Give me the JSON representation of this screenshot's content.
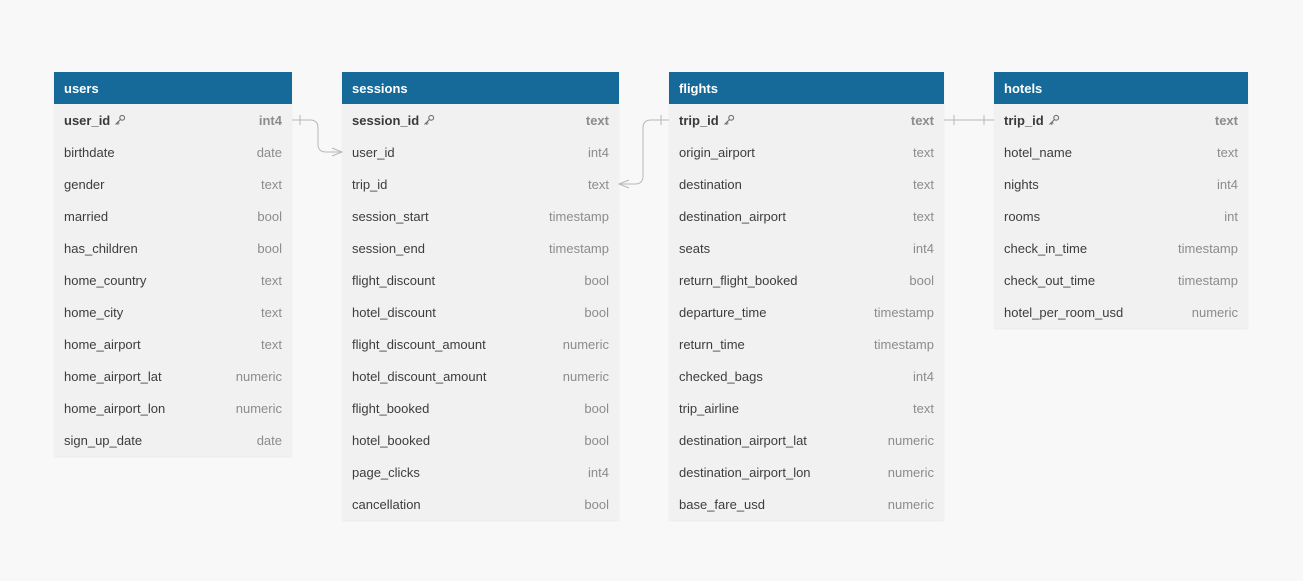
{
  "tables": {
    "users": {
      "name": "users",
      "fields": [
        {
          "name": "user_id",
          "type": "int4",
          "pk": true
        },
        {
          "name": "birthdate",
          "type": "date"
        },
        {
          "name": "gender",
          "type": "text"
        },
        {
          "name": "married",
          "type": "bool"
        },
        {
          "name": "has_children",
          "type": "bool"
        },
        {
          "name": "home_country",
          "type": "text"
        },
        {
          "name": "home_city",
          "type": "text"
        },
        {
          "name": "home_airport",
          "type": "text"
        },
        {
          "name": "home_airport_lat",
          "type": "numeric"
        },
        {
          "name": "home_airport_lon",
          "type": "numeric"
        },
        {
          "name": "sign_up_date",
          "type": "date"
        }
      ]
    },
    "sessions": {
      "name": "sessions",
      "fields": [
        {
          "name": "session_id",
          "type": "text",
          "pk": true
        },
        {
          "name": "user_id",
          "type": "int4"
        },
        {
          "name": "trip_id",
          "type": "text"
        },
        {
          "name": "session_start",
          "type": "timestamp"
        },
        {
          "name": "session_end",
          "type": "timestamp"
        },
        {
          "name": "flight_discount",
          "type": "bool"
        },
        {
          "name": "hotel_discount",
          "type": "bool"
        },
        {
          "name": "flight_discount_amount",
          "type": "numeric"
        },
        {
          "name": "hotel_discount_amount",
          "type": "numeric"
        },
        {
          "name": "flight_booked",
          "type": "bool"
        },
        {
          "name": "hotel_booked",
          "type": "bool"
        },
        {
          "name": "page_clicks",
          "type": "int4"
        },
        {
          "name": "cancellation",
          "type": "bool"
        }
      ]
    },
    "flights": {
      "name": "flights",
      "fields": [
        {
          "name": "trip_id",
          "type": "text",
          "pk": true
        },
        {
          "name": "origin_airport",
          "type": "text"
        },
        {
          "name": "destination",
          "type": "text"
        },
        {
          "name": "destination_airport",
          "type": "text"
        },
        {
          "name": "seats",
          "type": "int4"
        },
        {
          "name": "return_flight_booked",
          "type": "bool"
        },
        {
          "name": "departure_time",
          "type": "timestamp"
        },
        {
          "name": "return_time",
          "type": "timestamp"
        },
        {
          "name": "checked_bags",
          "type": "int4"
        },
        {
          "name": "trip_airline",
          "type": "text"
        },
        {
          "name": "destination_airport_lat",
          "type": "numeric"
        },
        {
          "name": "destination_airport_lon",
          "type": "numeric"
        },
        {
          "name": "base_fare_usd",
          "type": "numeric"
        }
      ]
    },
    "hotels": {
      "name": "hotels",
      "fields": [
        {
          "name": "trip_id",
          "type": "text",
          "pk": true
        },
        {
          "name": "hotel_name",
          "type": "text"
        },
        {
          "name": "nights",
          "type": "int4"
        },
        {
          "name": "rooms",
          "type": "int"
        },
        {
          "name": "check_in_time",
          "type": "timestamp"
        },
        {
          "name": "check_out_time",
          "type": "timestamp"
        },
        {
          "name": "hotel_per_room_usd",
          "type": "numeric"
        }
      ]
    }
  },
  "relationships": [
    {
      "from": "users.user_id",
      "to": "sessions.user_id",
      "cardinality": "one-to-many"
    },
    {
      "from": "flights.trip_id",
      "to": "sessions.trip_id",
      "cardinality": "one-to-many"
    },
    {
      "from": "flights.trip_id",
      "to": "hotels.trip_id",
      "cardinality": "one-to-one"
    }
  ],
  "colors": {
    "header": "#166a9a",
    "table_body": "#f1f1f2",
    "background": "#f8f8f9",
    "connector": "#b8b8b8"
  },
  "icons": {
    "primary_key": "key-icon"
  }
}
